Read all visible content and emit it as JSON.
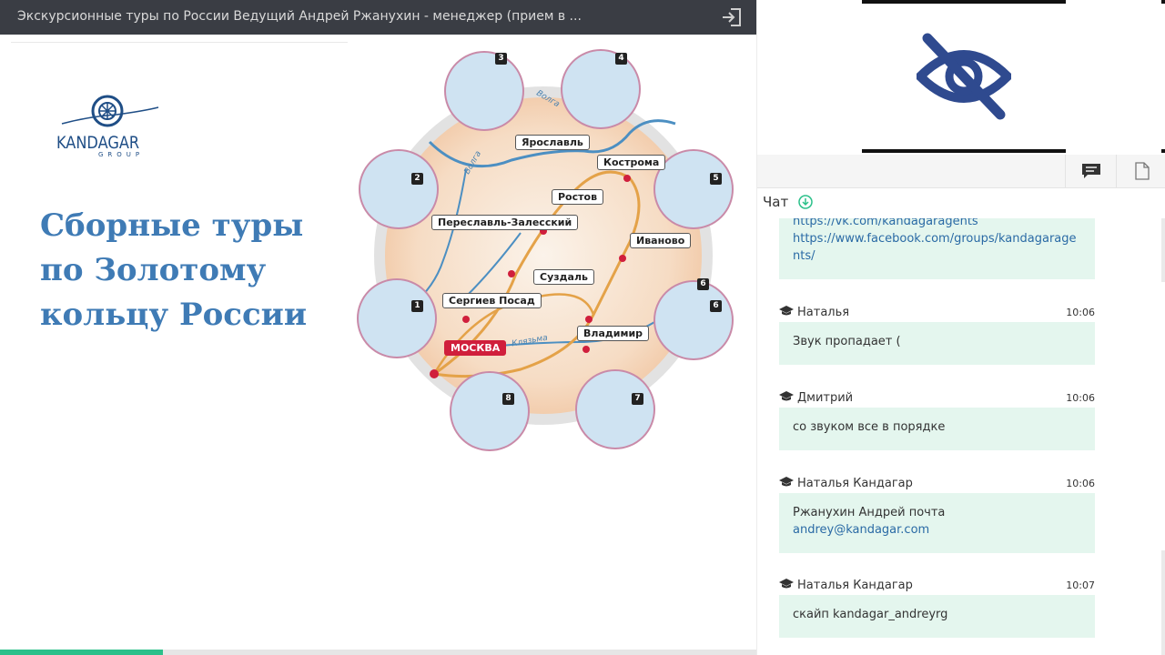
{
  "header": {
    "title": "Экскурсионные туры по России Ведущий Андрей Ржанухин - менеджер (прием в ...",
    "exit_icon": "exit-icon"
  },
  "slide": {
    "logo": {
      "wordmark": "KANDAGAR",
      "sub": "GROUP"
    },
    "title_lines": [
      "Сборные туры",
      "по Золотому",
      "кольцу России"
    ],
    "map": {
      "cities": [
        "Ярославль",
        "Кострома",
        "Ростов",
        "Переславль-Залесский",
        "Иваново",
        "Суздаль",
        "Сергиев Посад",
        "Владимир",
        "МОСКВА"
      ],
      "rivers": [
        "Волга",
        "Волга",
        "Клязьма"
      ],
      "badges": [
        "1",
        "2",
        "3",
        "4",
        "5",
        "6",
        "6",
        "7",
        "8"
      ]
    }
  },
  "progress": {
    "fraction": 0.215
  },
  "sidebar": {
    "video_icon": "eye-off-icon",
    "toolbar": {
      "chat_icon": "chat-icon",
      "notes_icon": "document-icon"
    },
    "chat_title": "Чат",
    "chat_download_icon": "download-circle-icon",
    "messages": [
      {
        "author": "",
        "time": "",
        "links": [
          "https://vk.com/kandagaragents",
          "https://www.facebook.com/groups/kandagaragents/"
        ]
      },
      {
        "author": "Наталья",
        "time": "10:06",
        "text": "Звук пропадает ("
      },
      {
        "author": "Дмитрий",
        "time": "10:06",
        "text": "со звуком все в порядке"
      },
      {
        "author": "Наталья Кандагар",
        "time": "10:06",
        "text": "Ржанухин Андрей почта",
        "link": "andrey@kandagar.com"
      },
      {
        "author": "Наталья Кандагар",
        "time": "10:07",
        "text": "скайп kandagar_andreyrg"
      }
    ]
  },
  "colors": {
    "header_bg": "#3a3d44",
    "title_blue": "#3f7bb5",
    "bubble_bg": "#e4f6ee",
    "progress": "#2bc08a",
    "moscow_red": "#d01f3c"
  }
}
